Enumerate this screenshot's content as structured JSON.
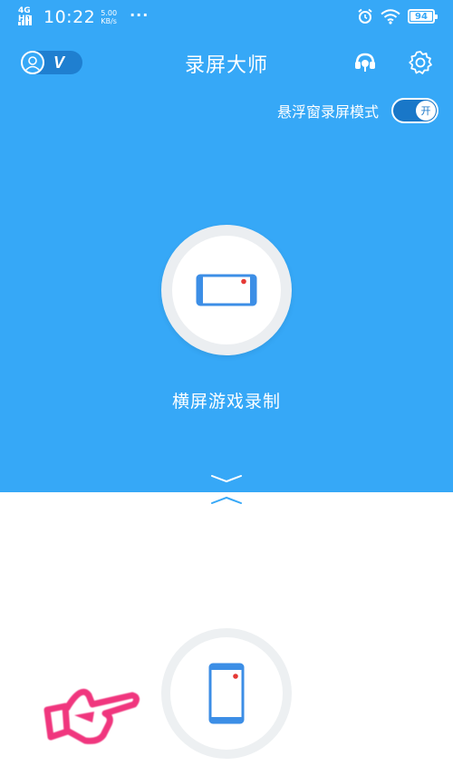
{
  "status_bar": {
    "network": "4G HD",
    "time": "10:22",
    "speed_value": "5.00",
    "speed_unit": "KB/s",
    "more": "···",
    "battery": "94"
  },
  "header": {
    "title": "录屏大师",
    "vip_badge": "V"
  },
  "floating_mode": {
    "label": "悬浮窗录屏模式",
    "toggle_text": "开",
    "enabled": true
  },
  "landscape": {
    "label": "横屏游戏录制"
  },
  "colors": {
    "primary": "#36a8f7",
    "record_dot": "#e53935",
    "phone_blue": "#3c8ee6",
    "hand_pink": "#f0367e"
  },
  "icons": {
    "avatar": "user-avatar-icon",
    "headset": "headset-icon",
    "settings": "gear-icon",
    "collapse": "chevron-down-icon",
    "expand": "chevron-up-icon"
  }
}
